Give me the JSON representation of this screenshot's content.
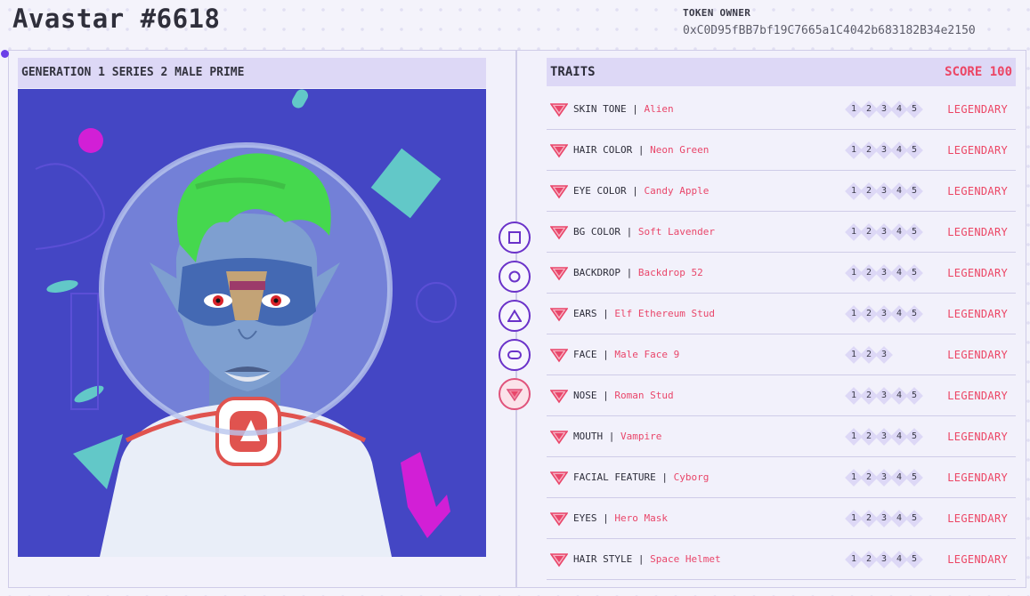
{
  "page": {
    "title": "Avastar #6618"
  },
  "owner": {
    "label": "TOKEN OWNER",
    "address": "0xC0D95fBB7bf19C7665a1C4042b683182B34e2150"
  },
  "avatar": {
    "header": "GENERATION 1 SERIES 2 MALE PRIME"
  },
  "toolbar": {
    "buttons": [
      {
        "name": "square-view-button",
        "icon": "square-icon"
      },
      {
        "name": "circle-view-button",
        "icon": "circle-icon"
      },
      {
        "name": "triangle-view-button",
        "icon": "triangle-icon"
      },
      {
        "name": "pill-view-button",
        "icon": "pill-icon"
      },
      {
        "name": "gem-view-button",
        "icon": "gem-icon",
        "active": true
      }
    ]
  },
  "traits": {
    "title": "TRAITS",
    "score": "SCORE 100",
    "items": [
      {
        "label": "SKIN TONE",
        "value": "Alien",
        "series": [
          "1",
          "2",
          "3",
          "4",
          "5"
        ],
        "rarity": "LEGENDARY"
      },
      {
        "label": "HAIR COLOR",
        "value": "Neon Green",
        "series": [
          "1",
          "2",
          "3",
          "4",
          "5"
        ],
        "rarity": "LEGENDARY"
      },
      {
        "label": "EYE COLOR",
        "value": "Candy Apple",
        "series": [
          "1",
          "2",
          "3",
          "4",
          "5"
        ],
        "rarity": "LEGENDARY"
      },
      {
        "label": "BG COLOR",
        "value": "Soft Lavender",
        "series": [
          "1",
          "2",
          "3",
          "4",
          "5"
        ],
        "rarity": "LEGENDARY"
      },
      {
        "label": "BACKDROP",
        "value": "Backdrop 52",
        "series": [
          "1",
          "2",
          "3",
          "4",
          "5"
        ],
        "rarity": "LEGENDARY"
      },
      {
        "label": "EARS",
        "value": "Elf Ethereum Stud",
        "series": [
          "1",
          "2",
          "3",
          "4",
          "5"
        ],
        "rarity": "LEGENDARY"
      },
      {
        "label": "FACE",
        "value": "Male Face 9",
        "series": [
          "1",
          "2",
          "3"
        ],
        "rarity": "LEGENDARY"
      },
      {
        "label": "NOSE",
        "value": "Roman Stud",
        "series": [
          "1",
          "2",
          "3",
          "4",
          "5"
        ],
        "rarity": "LEGENDARY"
      },
      {
        "label": "MOUTH",
        "value": "Vampire",
        "series": [
          "1",
          "2",
          "3",
          "4",
          "5"
        ],
        "rarity": "LEGENDARY"
      },
      {
        "label": "FACIAL FEATURE",
        "value": "Cyborg",
        "series": [
          "1",
          "2",
          "3",
          "4",
          "5"
        ],
        "rarity": "LEGENDARY"
      },
      {
        "label": "EYES",
        "value": "Hero Mask",
        "series": [
          "1",
          "2",
          "3",
          "4",
          "5"
        ],
        "rarity": "LEGENDARY"
      },
      {
        "label": "HAIR STYLE",
        "value": "Space Helmet",
        "series": [
          "1",
          "2",
          "3",
          "4",
          "5"
        ],
        "rarity": "LEGENDARY"
      }
    ]
  },
  "colors": {
    "accent": "#ec4665",
    "purple": "#6a32c9",
    "panel": "#ddd8f6",
    "art_bg": "#4446c4",
    "hair": "#45d84e",
    "skin": "#7e9fd0"
  }
}
